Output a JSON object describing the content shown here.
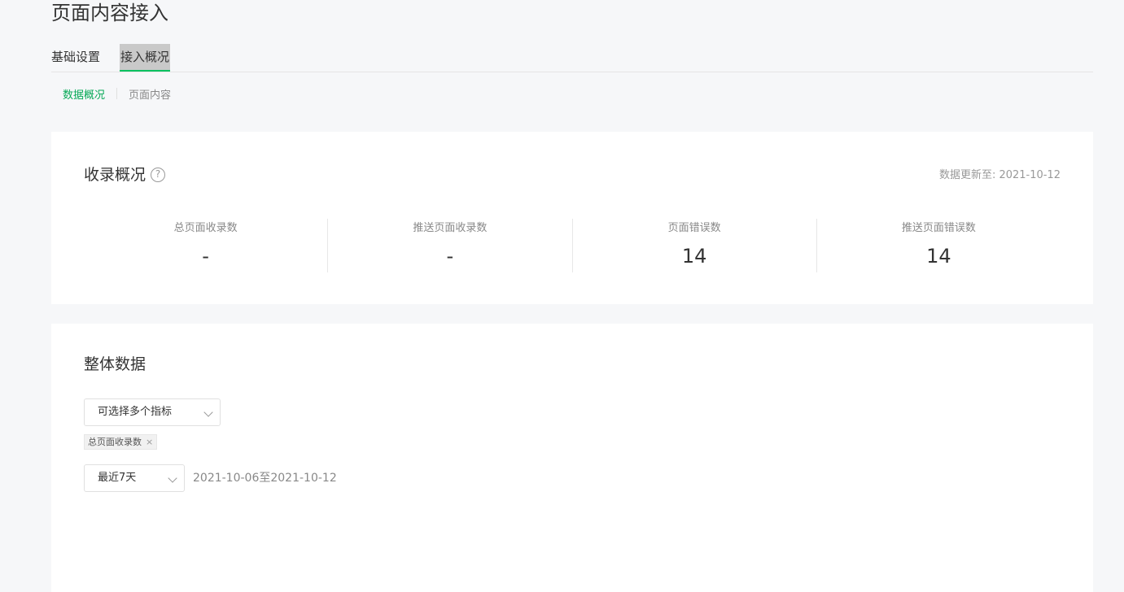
{
  "page": {
    "title": "页面内容接入"
  },
  "tabs": [
    {
      "label": "基础设置"
    },
    {
      "label": "接入概况"
    }
  ],
  "subtabs": [
    {
      "label": "数据概况"
    },
    {
      "label": "页面内容"
    }
  ],
  "overview": {
    "title": "收录概况",
    "help_symbol": "?",
    "update_text": "数据更新至: 2021-10-12",
    "stats": [
      {
        "label": "总页面收录数",
        "value": "-"
      },
      {
        "label": "推送页面收录数",
        "value": "-"
      },
      {
        "label": "页面错误数",
        "value": "14"
      },
      {
        "label": "推送页面错误数",
        "value": "14"
      }
    ]
  },
  "overall": {
    "title": "整体数据",
    "metrics_select": {
      "label": "可选择多个指标"
    },
    "tags": [
      {
        "label": "总页面收录数",
        "close": "×"
      }
    ],
    "range_select": {
      "label": "最近7天"
    },
    "date_range": "2021-10-06至2021-10-12"
  },
  "colors": {
    "accent": "#07c160",
    "active_subtab": "#07a957",
    "background": "#f6f7f9"
  }
}
